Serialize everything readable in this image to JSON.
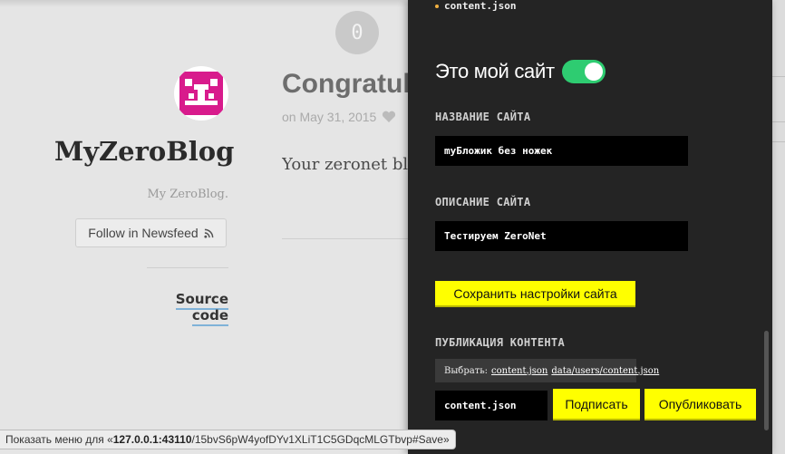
{
  "badge": {
    "count": "0"
  },
  "blog": {
    "title": "MyZeroBlog",
    "description": "My ZeroBlog.",
    "follow_label": "Follow in Newsfeed",
    "source_label": "Source code"
  },
  "post": {
    "title": "Congratula",
    "date": "on May 31, 2015",
    "body": "Your zeronet blo"
  },
  "panel": {
    "file_name": "content.json",
    "own_site_label": "Это мой сайт",
    "own_site_enabled": true,
    "site_name_label": "НАЗВАНИЕ САЙТА",
    "site_name_value": "myБложик без ножек",
    "site_desc_label": "ОПИСАНИЕ САЙТА",
    "site_desc_value": "Тестируем ZeroNet",
    "save_button": "Сохранить настройки сайта",
    "publish_label": "ПУБЛИКАЦИЯ КОНТЕНТА",
    "choose_prefix": "Выбрать:",
    "choose_option_1": "content.json",
    "choose_option_2": "data/users/content.json",
    "publish_input": "content.json",
    "sign_button": "Подписать",
    "publish_button": "Опубликовать"
  },
  "status": {
    "prefix": "Показать меню для «",
    "host": "127.0.0.1:43110",
    "path": "/15bvS6pW4yofDYv1XLiT1C5GDqcMLGTbvp#Save»"
  },
  "colors": {
    "toggle_on": "#2ecc71",
    "button_yellow": "#ffff00",
    "panel_bg": "#242424",
    "avatar": "#d81b8c"
  }
}
